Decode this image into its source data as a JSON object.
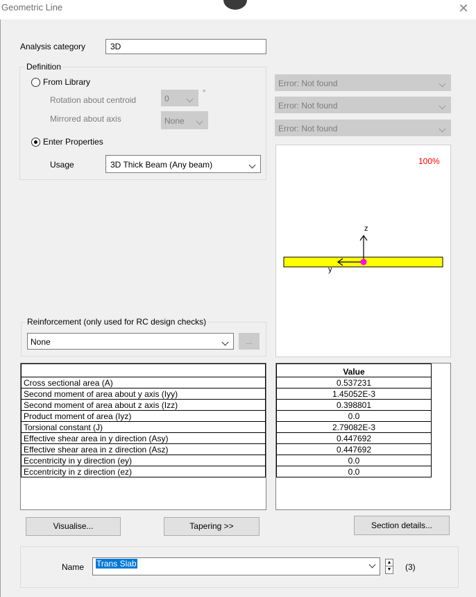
{
  "window": {
    "title": "Geometric Line"
  },
  "analysis": {
    "label": "Analysis category",
    "value": "3D"
  },
  "definition": {
    "title": "Definition",
    "from_library": "From Library",
    "rotation_label": "Rotation about centroid",
    "rotation_value": "0",
    "rotation_unit": "°",
    "mirrored_label": "Mirrored about axis",
    "mirrored_value": "None",
    "enter_properties": "Enter Properties",
    "usage_label": "Usage",
    "usage_value": "3D Thick Beam (Any beam)"
  },
  "library_combos": [
    "Error: Not found",
    "Error: Not found",
    "Error: Not found"
  ],
  "preview": {
    "zoom": "100%",
    "z_axis": "z",
    "y_axis": "y",
    "section_color": "#ffff00",
    "centroid_color": "#ff00ff"
  },
  "reinforcement": {
    "title": "Reinforcement (only used for RC design checks)",
    "value": "None",
    "browse": "..."
  },
  "properties": {
    "rows": [
      "Cross sectional area (A)",
      "Second moment of area about y axis (Iyy)",
      "Second moment of area about z axis (Izz)",
      "Product moment of area (Iyz)",
      "Torsional constant (J)",
      "Effective shear area in y direction (Asy)",
      "Effective shear area in z direction (Asz)",
      "Eccentricity in y direction (ey)",
      "Eccentricity in z direction (ez)"
    ],
    "value_header": "Value",
    "values": [
      "0.537231",
      "1.45052E-3",
      "0.398801",
      "0.0",
      "2.79082E-3",
      "0.447692",
      "0.447692",
      "0.0",
      "0.0"
    ]
  },
  "buttons": {
    "visualise": "Visualise...",
    "tapering": "Tapering >>",
    "section_details": "Section details..."
  },
  "name": {
    "label": "Name",
    "value": "Trans Slab",
    "count": "(3)"
  }
}
